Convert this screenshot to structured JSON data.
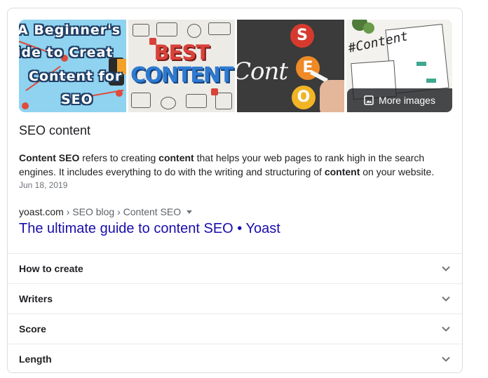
{
  "images": {
    "tile1_text": [
      "A Beginner's",
      "ide to Creat",
      "Content for",
      "SEO"
    ],
    "tile2_text": [
      "BEST",
      "CONTENT"
    ],
    "tile3_text": {
      "letters": [
        "S",
        "E",
        "O"
      ],
      "word": "Cont"
    },
    "tile4_text": "#Content",
    "more_label": "More images"
  },
  "result": {
    "title": "SEO content",
    "snippet": {
      "b1": "Content SEO",
      "t1": " refers to creating ",
      "b2": "content",
      "t2": " that helps your web pages to rank high in the search engines. It includes everything to do with the writing and structuring of ",
      "b3": "content",
      "t3": " on your website."
    },
    "date": "Jun 18, 2019",
    "breadcrumb": {
      "host": "yoast.com",
      "sep": " › ",
      "p1": "SEO blog",
      "p2": "Content SEO"
    },
    "link_title": "The ultimate guide to content SEO • Yoast"
  },
  "accordion": [
    {
      "label": "How to create"
    },
    {
      "label": "Writers"
    },
    {
      "label": "Score"
    },
    {
      "label": "Length"
    }
  ],
  "colors": {
    "link": "#1a0dab",
    "muted": "#70757a",
    "border": "#dadce0"
  }
}
